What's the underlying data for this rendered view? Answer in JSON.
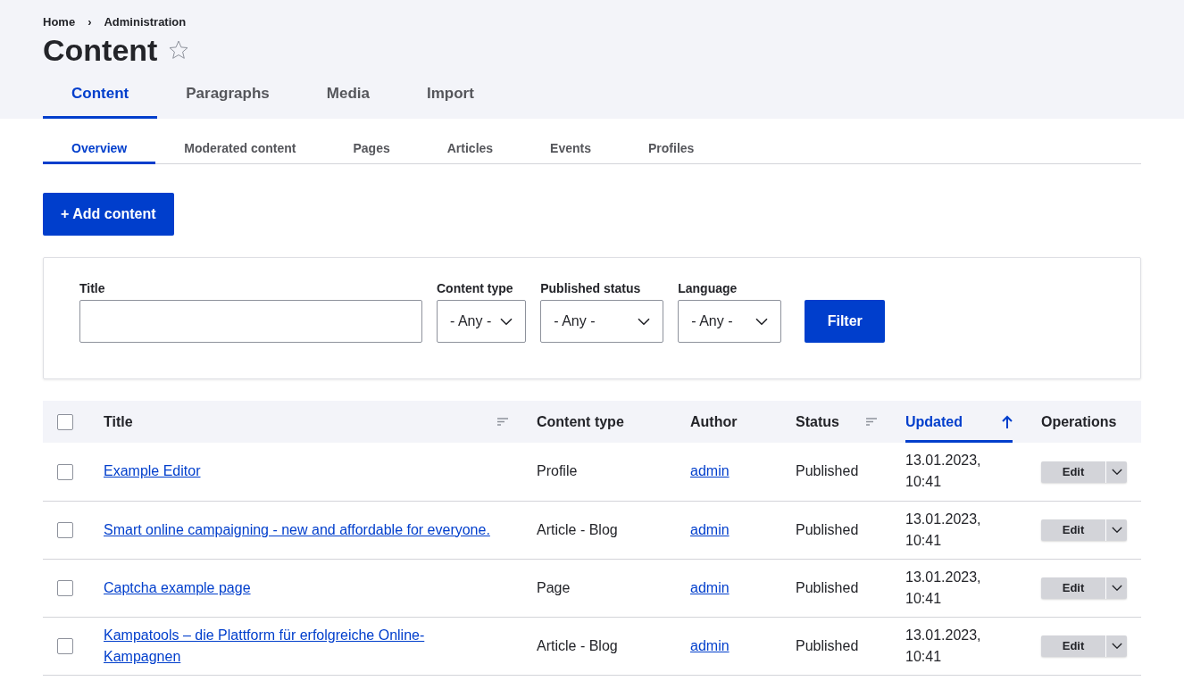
{
  "breadcrumb": [
    {
      "label": "Home"
    },
    {
      "label": "Administration"
    }
  ],
  "breadcrumb_separator": "›",
  "title": "Content",
  "favorite": {
    "on": false
  },
  "primary_tabs": [
    {
      "label": "Content",
      "selected": true
    },
    {
      "label": "Paragraphs",
      "selected": false
    },
    {
      "label": "Media",
      "selected": false
    },
    {
      "label": "Import",
      "selected": false
    }
  ],
  "secondary_tabs": [
    {
      "label": "Overview",
      "selected": true
    },
    {
      "label": "Moderated content",
      "selected": false
    },
    {
      "label": "Pages",
      "selected": false
    },
    {
      "label": "Articles",
      "selected": false
    },
    {
      "label": "Events",
      "selected": false
    },
    {
      "label": "Profiles",
      "selected": false
    }
  ],
  "add_button": "+ Add content",
  "filters": [
    {
      "kind": "text",
      "label": "Title"
    },
    {
      "kind": "select",
      "label": "Content type",
      "value": "- Any -"
    },
    {
      "kind": "select",
      "label": "Published status",
      "value": "- Any -"
    },
    {
      "kind": "select",
      "label": "Language",
      "value": "- Any -"
    }
  ],
  "filter_button": "Filter",
  "table": {
    "select_all": {
      "checked": false
    },
    "columns": [
      {
        "label": "Title",
        "kind": "sortable"
      },
      {
        "label": "Content type",
        "kind": "plain"
      },
      {
        "label": "Author",
        "kind": "plain"
      },
      {
        "label": "Status",
        "kind": "sortable"
      },
      {
        "label": "Updated",
        "kind": "sorted"
      },
      {
        "label": "Operations",
        "kind": "plain"
      }
    ],
    "rows": [
      {
        "checked": false,
        "title": "Example Editor",
        "type": "Profile",
        "author": "admin",
        "status": "Published",
        "updated": [
          "13.01.2023,",
          "10:41"
        ],
        "operation": "Edit"
      },
      {
        "checked": false,
        "title": "Smart online campaigning - new and affordable for everyone.",
        "type": "Article - Blog",
        "author": "admin",
        "status": "Published",
        "updated": [
          "13.01.2023,",
          "10:41"
        ],
        "operation": "Edit"
      },
      {
        "checked": false,
        "title": "Captcha example page",
        "type": "Page",
        "author": "admin",
        "status": "Published",
        "updated": [
          "13.01.2023,",
          "10:41"
        ],
        "operation": "Edit"
      },
      {
        "checked": false,
        "title": "Kampatools – die Plattform für erfolgreiche Online-Kampagnen",
        "type": "Article - Blog",
        "author": "admin",
        "status": "Published",
        "updated": [
          "13.01.2023,",
          "10:41"
        ],
        "operation": "Edit"
      }
    ]
  }
}
